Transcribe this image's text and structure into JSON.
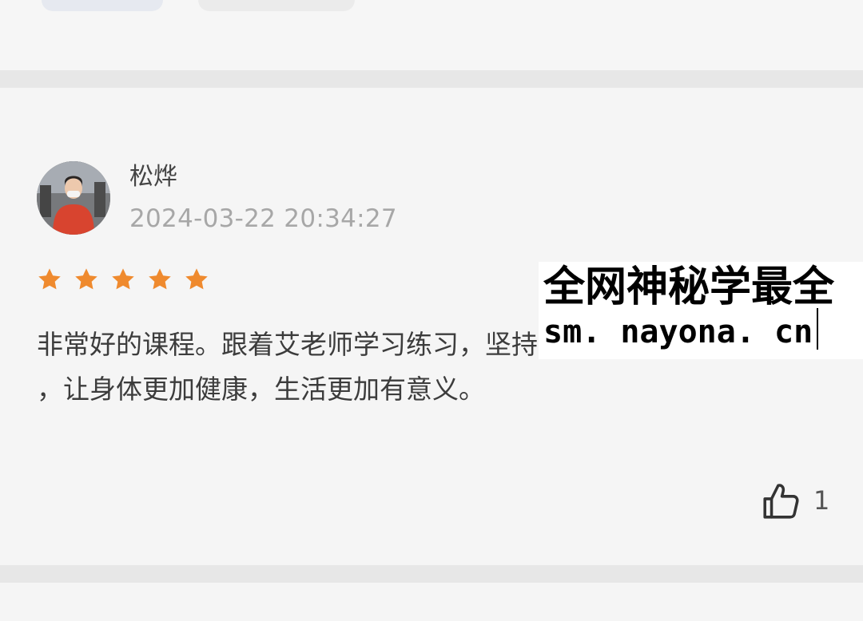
{
  "review": {
    "username": "松烨",
    "timestamp": "2024-03-22 20:34:27",
    "rating": 5,
    "text": "非常好的课程。跟着艾老师学习练习，坚持每天都能有所收获\n，让身体更加健康，生活更加有意义。",
    "like_count": "1",
    "star_color": "#ef8a2e"
  },
  "watermark": {
    "line1": "全网神秘学最全",
    "line2": "sm. nayona. cn"
  }
}
